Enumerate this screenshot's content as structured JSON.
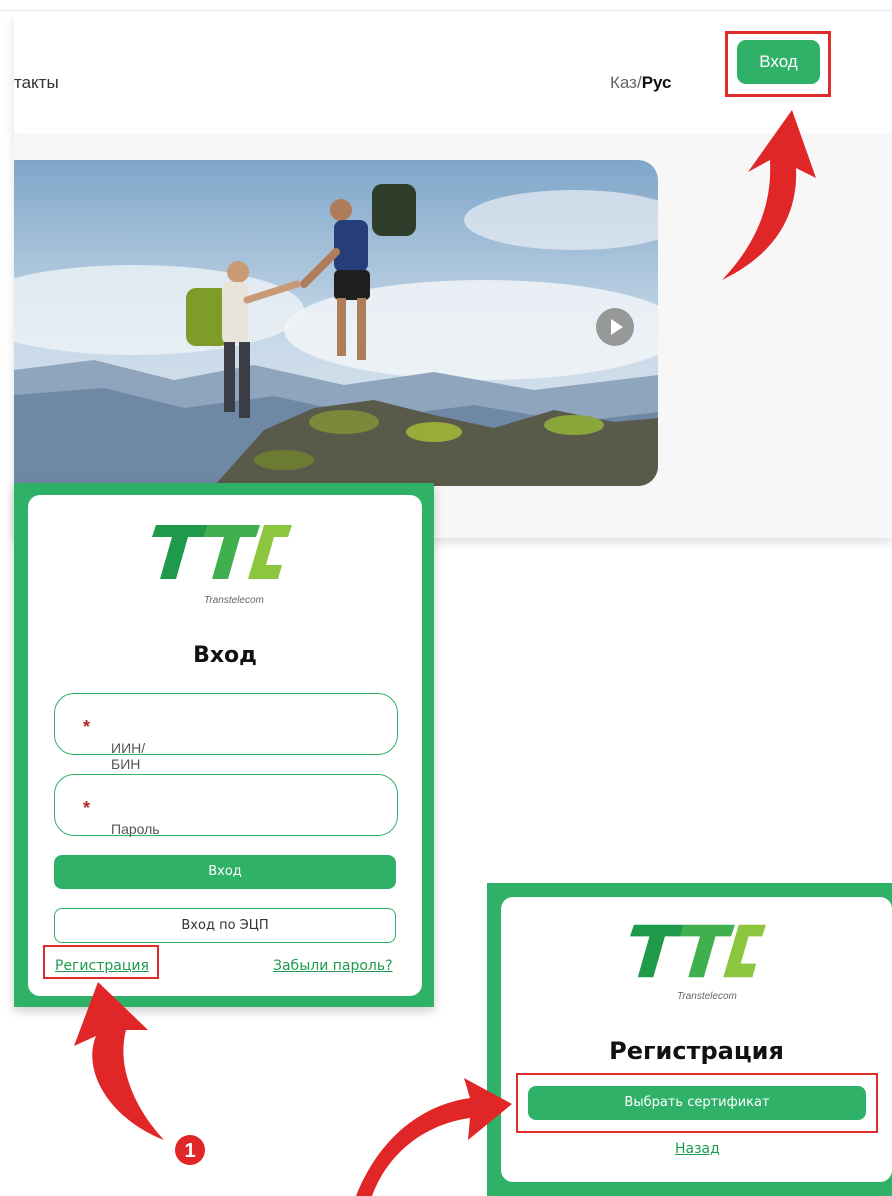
{
  "header": {
    "nav_partial": "такты",
    "lang_kaz": "Каз/",
    "lang_rus": "Рус",
    "login_button": "Вход"
  },
  "login_card": {
    "logo_caption": "Transtelecom",
    "title": "Вход",
    "iin_placeholder": "ИИН/БИН",
    "password_placeholder": "Пароль",
    "required_mark": "*",
    "submit_label": "Вход",
    "ecp_label": "Вход по ЭЦП",
    "register_link": "Регистрация",
    "forgot_link": "Забыли пароль?"
  },
  "register_card": {
    "logo_caption": "Transtelecom",
    "title": "Регистрация",
    "choose_cert": "Выбрать сертификат",
    "back_link": "Назад"
  },
  "annotations": {
    "step_number": "1",
    "arrow_color": "#e02626",
    "highlight_color": "#e02b2b"
  },
  "colors": {
    "brand_green": "#2fb168",
    "logo_green_dark": "#1f9a4a",
    "logo_green_light": "#8cc63f"
  }
}
